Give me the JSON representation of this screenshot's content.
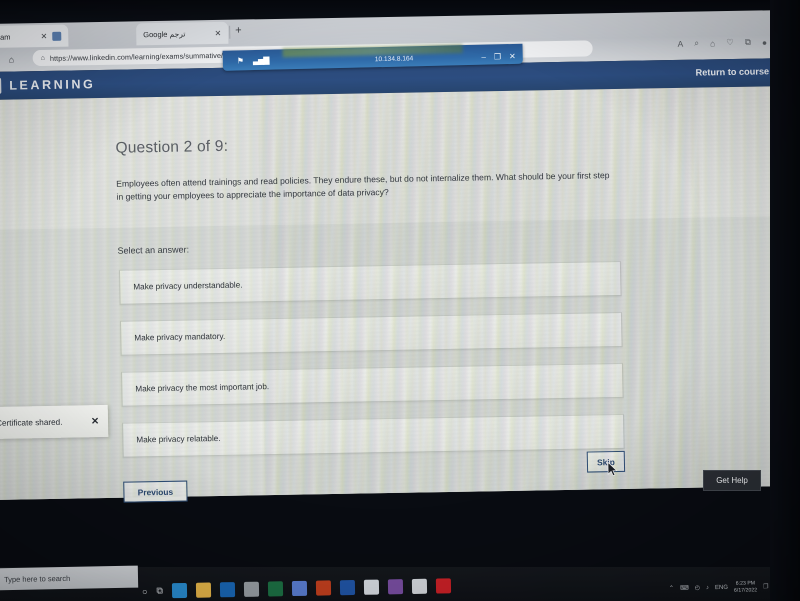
{
  "browser": {
    "tabs": [
      {
        "label": "...tive Exam",
        "close": "✕",
        "active": true
      },
      {
        "label": "Google ترجم",
        "close": "✕",
        "active": false
      }
    ],
    "new_tab": "+",
    "nav": {
      "back": "←",
      "home": "⌂"
    },
    "url": "https://www.linkedin.com/learning/exams/summative/courses/creating-a-culture-of-privacy?u=132763834",
    "lock_icon": "⌂",
    "toolbar_icons": [
      "A",
      "⌕",
      "⌂",
      "♡",
      "⧉",
      "●",
      "⋯"
    ]
  },
  "remote_bar": {
    "pin_icon": "⚑",
    "signal_icon": "▃▅▇",
    "ip": "10.134.8.164",
    "minimize": "–",
    "restore": "❐",
    "close": "✕"
  },
  "site_header": {
    "logo_mark": "in",
    "logo_text": "LEARNING",
    "return_link": "Return to course",
    "brand_color": "#2c4d80"
  },
  "quiz": {
    "title": "Question 2 of 9:",
    "question": "Employees often attend trainings and read policies. They endure these, but do not internalize them. What should be your first step in getting your employees to appreciate the importance of data privacy?",
    "select_label": "Select an answer:",
    "answers": [
      "Make privacy understandable.",
      "Make privacy mandatory.",
      "Make privacy the most important job.",
      "Make privacy relatable."
    ],
    "previous_button": "Previous",
    "skip_button": "Skip"
  },
  "toast": {
    "message": "Certificate shared.",
    "close": "✕"
  },
  "help": {
    "label": "Get Help"
  },
  "taskbar": {
    "search_placeholder": "Type here to search",
    "start_icon": "○",
    "taskview_icon": "⧉",
    "apps": [
      {
        "name": "edge-icon",
        "color": "#2a8fd4"
      },
      {
        "name": "file-explorer-icon",
        "color": "#e9b84a"
      },
      {
        "name": "outlook-icon",
        "color": "#1a68b8"
      },
      {
        "name": "chrome-icon",
        "color": "#9aa0a6"
      },
      {
        "name": "excel-icon",
        "color": "#1d7145"
      },
      {
        "name": "teams-icon",
        "color": "#5b7fd4"
      },
      {
        "name": "powerpoint-icon",
        "color": "#c4401f"
      },
      {
        "name": "word-icon",
        "color": "#2156a8"
      },
      {
        "name": "photos-icon",
        "color": "#d8dde4"
      },
      {
        "name": "onenote-icon",
        "color": "#7a4fa3"
      },
      {
        "name": "calculator-icon",
        "color": "#d5d9de"
      },
      {
        "name": "adobe-icon",
        "color": "#cc2127"
      }
    ],
    "tray": {
      "chevron": "⌃",
      "chat_icon": "⌨",
      "network_icon": "◴",
      "sound_icon": "♪",
      "lang": "ENG",
      "time": "6:23 PM",
      "date": "6/17/2022",
      "notification_icon": "❐"
    }
  }
}
